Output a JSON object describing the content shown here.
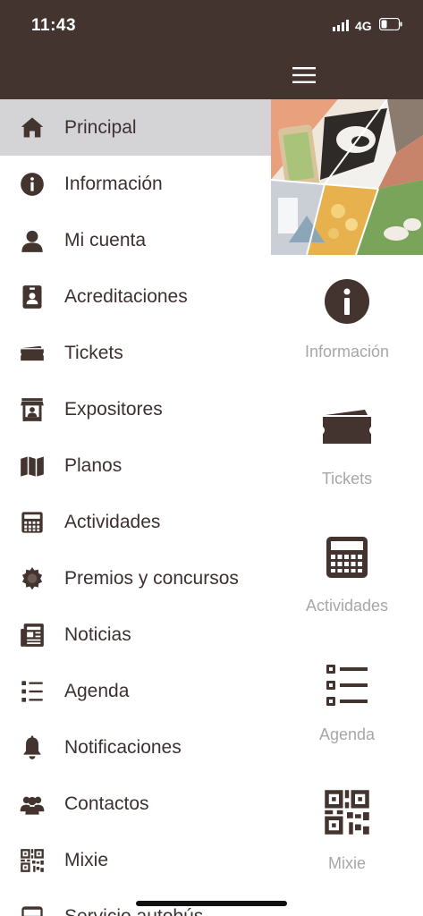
{
  "status": {
    "time": "11:43",
    "network": "4G"
  },
  "sidebar": {
    "items": [
      {
        "label": "Principal",
        "icon": "home-icon",
        "active": true
      },
      {
        "label": "Información",
        "icon": "info-icon"
      },
      {
        "label": "Mi cuenta",
        "icon": "user-icon"
      },
      {
        "label": "Acreditaciones",
        "icon": "badge-icon"
      },
      {
        "label": "Tickets",
        "icon": "ticket-icon"
      },
      {
        "label": "Expositores",
        "icon": "stand-icon"
      },
      {
        "label": "Planos",
        "icon": "map-icon"
      },
      {
        "label": "Actividades",
        "icon": "calculator-icon"
      },
      {
        "label": "Premios y concursos",
        "icon": "award-icon"
      },
      {
        "label": "Noticias",
        "icon": "newspaper-icon"
      },
      {
        "label": "Agenda",
        "icon": "list-icon"
      },
      {
        "label": "Notificaciones",
        "icon": "bell-icon"
      },
      {
        "label": "Contactos",
        "icon": "contacts-icon"
      },
      {
        "label": "Mixie",
        "icon": "qr-icon"
      },
      {
        "label": "Servicio autobús",
        "icon": "bus-icon"
      }
    ]
  },
  "quick": [
    {
      "label": "Información",
      "icon": "info-icon"
    },
    {
      "label": "Tickets",
      "icon": "ticket-icon"
    },
    {
      "label": "Actividades",
      "icon": "calculator-icon"
    },
    {
      "label": "Agenda",
      "icon": "list-icon"
    },
    {
      "label": "Mixie",
      "icon": "qr-icon"
    }
  ],
  "colors": {
    "brand": "#43342f",
    "active_bg": "#d4d4d6",
    "text": "#3d3130",
    "muted": "#a7a7a7"
  }
}
